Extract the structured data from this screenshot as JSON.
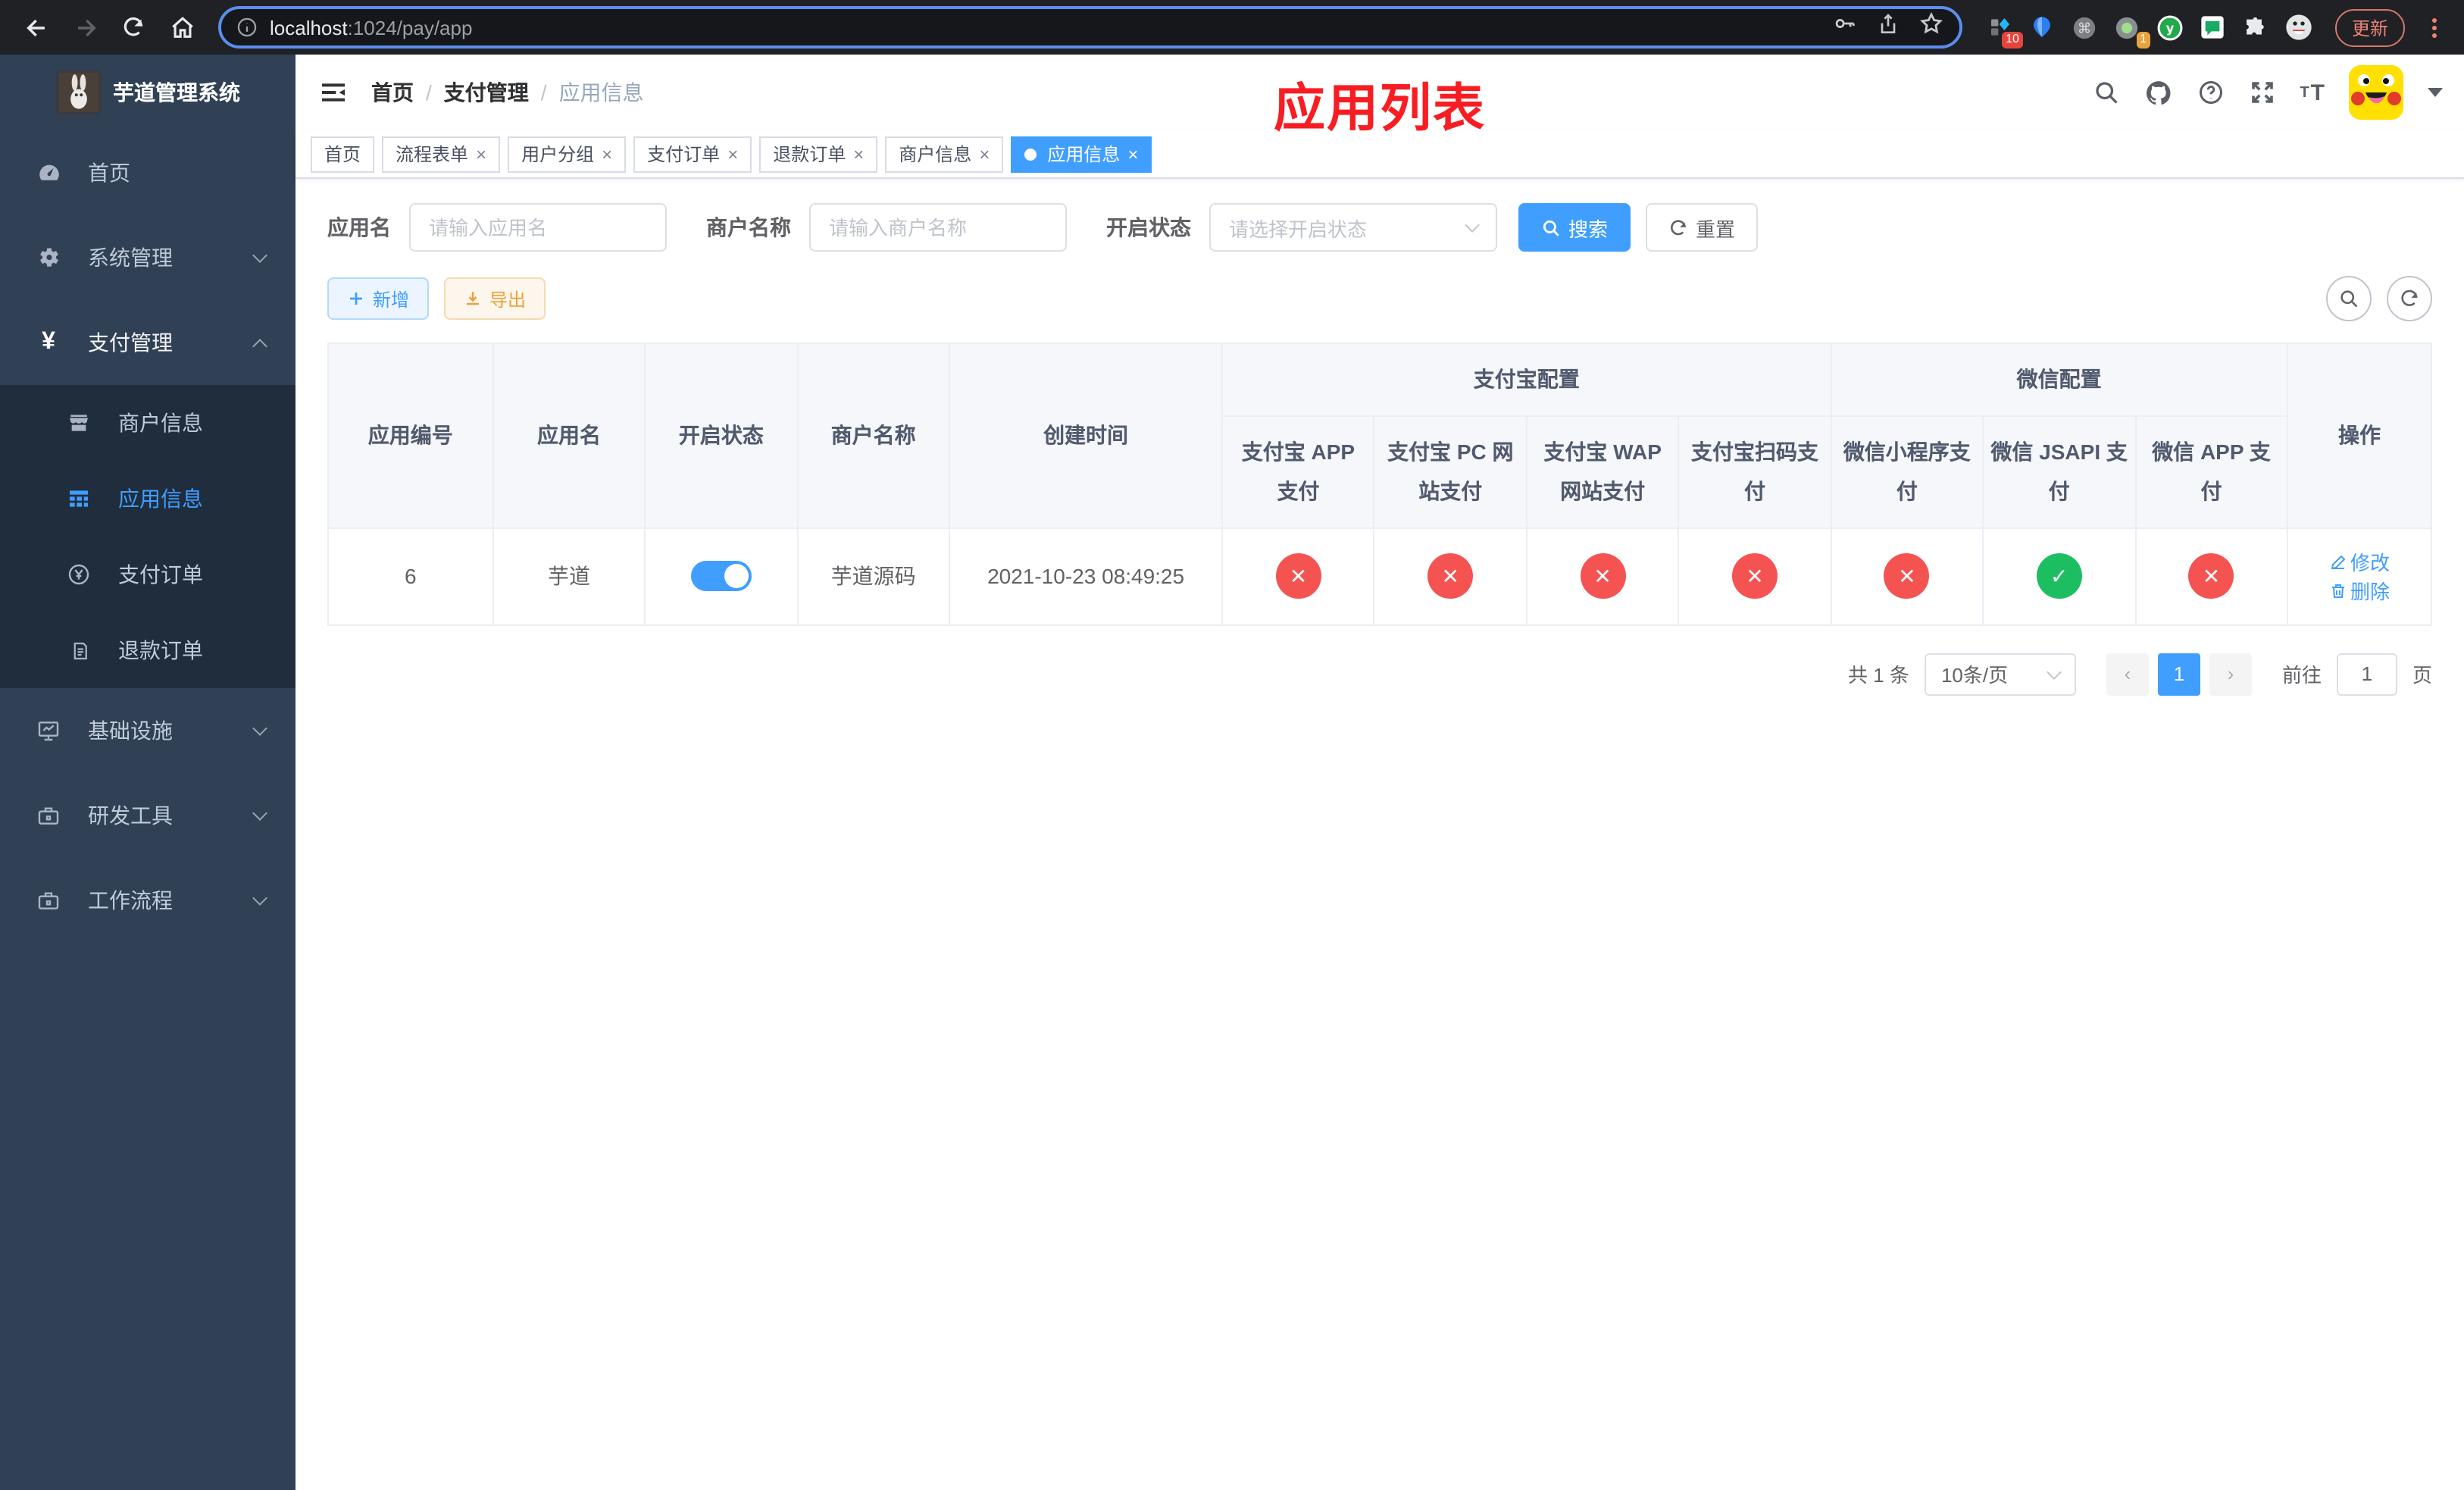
{
  "browser": {
    "url_host": "localhost",
    "url_path": ":1024/pay/app",
    "update_button": "更新",
    "extensions": {
      "badge_designer": "10",
      "badge_recorder": "1"
    }
  },
  "sidebar": {
    "title": "芋道管理系统",
    "items": [
      {
        "label": "首页"
      },
      {
        "label": "系统管理"
      },
      {
        "label": "支付管理"
      },
      {
        "label": "商户信息"
      },
      {
        "label": "应用信息"
      },
      {
        "label": "支付订单"
      },
      {
        "label": "退款订单"
      },
      {
        "label": "基础设施"
      },
      {
        "label": "研发工具"
      },
      {
        "label": "工作流程"
      }
    ]
  },
  "header": {
    "breadcrumb": [
      {
        "label": "首页"
      },
      {
        "label": "支付管理"
      },
      {
        "label": "应用信息"
      }
    ],
    "overlay_title": "应用列表"
  },
  "tabs": [
    {
      "label": "首页",
      "active": false
    },
    {
      "label": "流程表单",
      "active": false
    },
    {
      "label": "用户分组",
      "active": false
    },
    {
      "label": "支付订单",
      "active": false
    },
    {
      "label": "退款订单",
      "active": false
    },
    {
      "label": "商户信息",
      "active": false
    },
    {
      "label": "应用信息",
      "active": true
    }
  ],
  "filters": {
    "app_name_label": "应用名",
    "app_name_placeholder": "请输入应用名",
    "merchant_label": "商户名称",
    "merchant_placeholder": "请输入商户名称",
    "status_label": "开启状态",
    "status_placeholder": "请选择开启状态",
    "search_button": "搜索",
    "reset_button": "重置"
  },
  "toolbar": {
    "add_button": "新增",
    "export_button": "导出"
  },
  "table": {
    "col_id": "应用编号",
    "col_name": "应用名",
    "col_status": "开启状态",
    "col_merchant": "商户名称",
    "col_created": "创建时间",
    "group_alipay": "支付宝配置",
    "group_wechat": "微信配置",
    "col_ops": "操作",
    "sub_cols": [
      "支付宝 APP 支付",
      "支付宝 PC 网站支付",
      "支付宝 WAP 网站支付",
      "支付宝扫码支付",
      "微信小程序支付",
      "微信 JSAPI 支付",
      "微信 APP 支付"
    ],
    "row": {
      "id": "6",
      "name": "芋道",
      "enabled": true,
      "merchant": "芋道源码",
      "created": "2021-10-23 08:49:25",
      "statuses": [
        false,
        false,
        false,
        false,
        false,
        true,
        false
      ],
      "edit_label": "修改",
      "delete_label": "删除"
    }
  },
  "pagination": {
    "total": "共 1 条",
    "page_size": "10条/页",
    "page": "1",
    "goto_label": "前往",
    "goto_value": "1",
    "goto_suffix": "页"
  },
  "colors": {
    "accent": "#409eff",
    "fail": "#f45352",
    "pass": "#1dbe62",
    "sidebar": "#304156",
    "title_red": "#f81d22"
  }
}
